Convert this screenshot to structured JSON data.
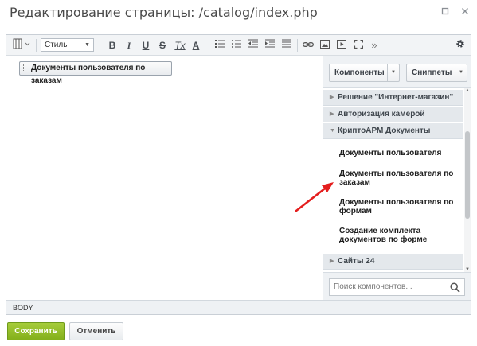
{
  "window": {
    "title": "Редактирование страницы: /catalog/index.php",
    "minimize_icon": "restore-icon",
    "close_icon": "close-icon"
  },
  "toolbar": {
    "style_select": "Стиль",
    "bold": "B",
    "italic": "I",
    "underline": "U",
    "strike": "S",
    "remove_format": "Tx",
    "text_color": "A",
    "more": "»"
  },
  "content": {
    "component_chip": "Документы пользователя по заказам"
  },
  "sidebar": {
    "components_button": "Компоненты",
    "snippets_button": "Сниппеты",
    "categories": [
      {
        "label": "Решение \"Интернет-магазин\"",
        "expanded": false
      },
      {
        "label": "Авторизация камерой",
        "expanded": false
      },
      {
        "label": "КриптоАРМ Документы",
        "expanded": true
      },
      {
        "label": "Сайты 24",
        "expanded": false
      }
    ],
    "items": [
      "Документы пользователя",
      "Документы пользователя по заказам",
      "Документы пользователя по формам",
      "Создание комплекта документов по форме"
    ],
    "search_placeholder": "Поиск компонентов..."
  },
  "statusbar": {
    "path": "BODY"
  },
  "footer": {
    "save_label": "Сохранить",
    "cancel_label": "Отменить"
  },
  "colors": {
    "save_green": "#8ab624",
    "annotation_arrow": "#e41e1e"
  }
}
